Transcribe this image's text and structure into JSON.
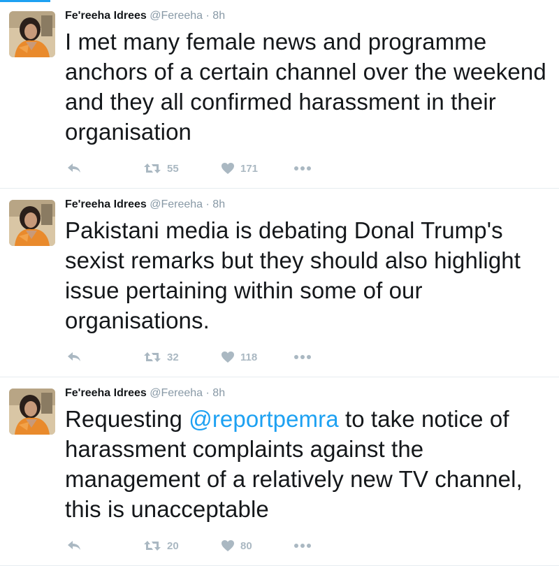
{
  "tweets": [
    {
      "name": "Fe'reeha Idrees",
      "handle": "@Fereeha",
      "separator": "·",
      "time": "8h",
      "text_before": "I met many female news and programme anchors of a certain channel over the weekend and they all confirmed harassment in their organisation",
      "mention": "",
      "text_after": "",
      "retweets": "55",
      "likes": "171"
    },
    {
      "name": "Fe'reeha Idrees",
      "handle": "@Fereeha",
      "separator": "·",
      "time": "8h",
      "text_before": "Pakistani media is debating Donal Trump's sexist remarks but they should also highlight issue pertaining within some of our organisations.",
      "mention": "",
      "text_after": "",
      "retweets": "32",
      "likes": "118"
    },
    {
      "name": "Fe'reeha Idrees",
      "handle": "@Fereeha",
      "separator": "·",
      "time": "8h",
      "text_before": "Requesting ",
      "mention": "@reportpemra",
      "text_after": " to take notice of harassment complaints against the management of a relatively new TV channel, this is unacceptable",
      "retweets": "20",
      "likes": "80"
    }
  ],
  "colors": {
    "accent": "#1da1f2",
    "text": "#14171a",
    "muted": "#8899a6",
    "icon": "#aab8c2"
  },
  "icons": {
    "reply": "reply-icon",
    "retweet": "retweet-icon",
    "like": "heart-icon",
    "more": "more-dots-icon"
  }
}
